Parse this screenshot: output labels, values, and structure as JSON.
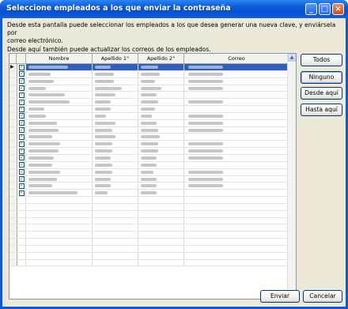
{
  "window": {
    "title": "Seleccione empleados a los que enviar la contraseña"
  },
  "description": {
    "line1": "Desde esta pantalla puede seleccionar los empleados a los que desea generar una nueva clave,  y enviársela por",
    "line2": "correo electrónico.",
    "line3": "Desde aquí también puede actualizar los correos de los empleados."
  },
  "grid": {
    "columns": [
      "Nombre",
      "Apellido 1°",
      "Apellido 2°",
      "Correo"
    ],
    "rows_checked": 19,
    "empty_rows": 10
  },
  "side_buttons": {
    "todos": "Todos",
    "ninguno": "Ninguno",
    "desde": "Desde aquí",
    "hasta": "Hasta aquí"
  },
  "footer": {
    "enviar": "Enviar",
    "cancelar": "Cancelar"
  },
  "icons": {
    "minimize": "minimize-icon",
    "maximize": "maximize-icon",
    "close": "close-icon",
    "row_pointer": "row-pointer-icon",
    "checkbox": "checkbox-icon"
  },
  "colors": {
    "titlebar": "#0a58d8",
    "selected_row": "#2e5fc5",
    "check": "#21a121"
  }
}
